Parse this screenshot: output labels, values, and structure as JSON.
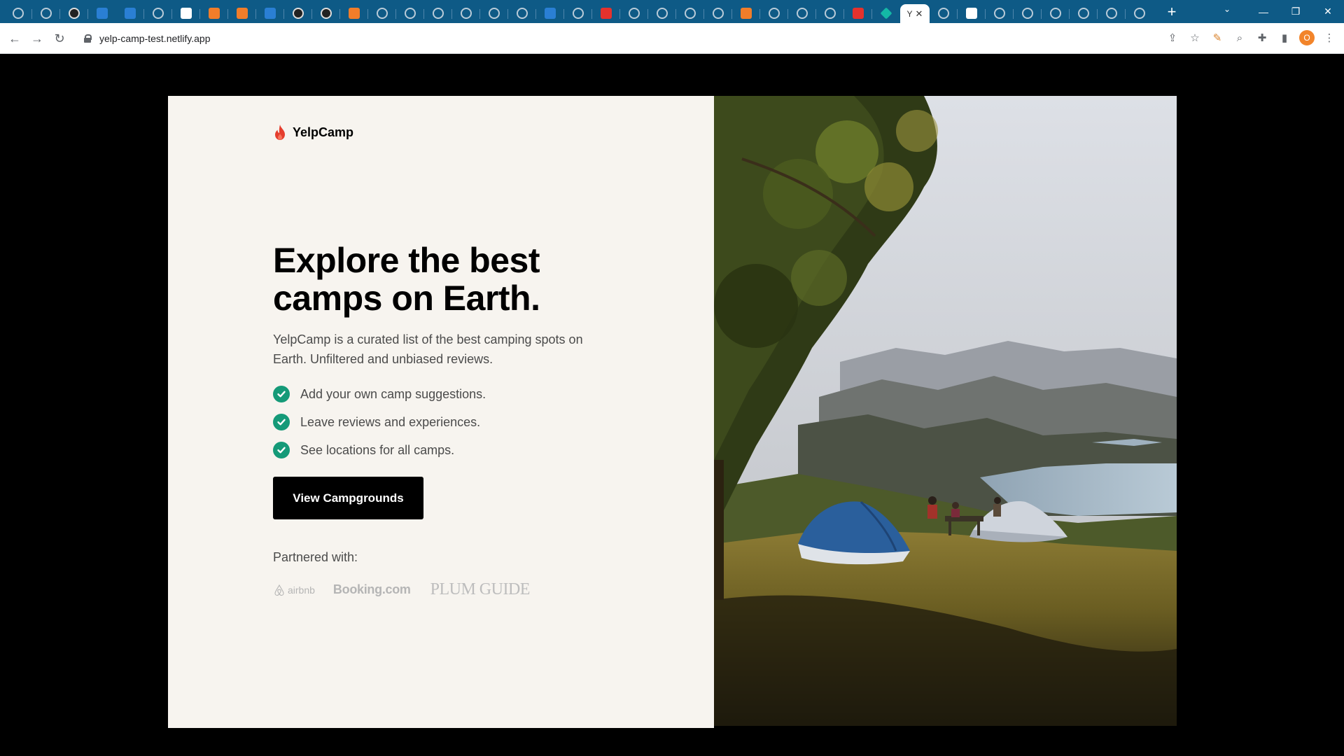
{
  "browser": {
    "url": "yelp-camp-test.netlify.app",
    "active_tab_label": "Y",
    "profile_initial": "O",
    "window_controls": [
      "—",
      "❐",
      "✕"
    ]
  },
  "site": {
    "brand": "YelpCamp",
    "headline": "Explore the best camps on Earth.",
    "description": "YelpCamp is a curated list of the best camping spots on Earth. Unfiltered and unbiased reviews.",
    "features": [
      "Add your own camp suggestions.",
      "Leave reviews and experiences.",
      "See locations for all camps."
    ],
    "cta_label": "View Campgrounds",
    "partners_label": "Partnered with:",
    "partners": [
      "airbnb",
      "Booking.com",
      "PLUM GUIDE"
    ]
  },
  "colors": {
    "accent_check": "#159a78",
    "flame": "#e53e2e",
    "page_bg": "#f7f4ef"
  }
}
